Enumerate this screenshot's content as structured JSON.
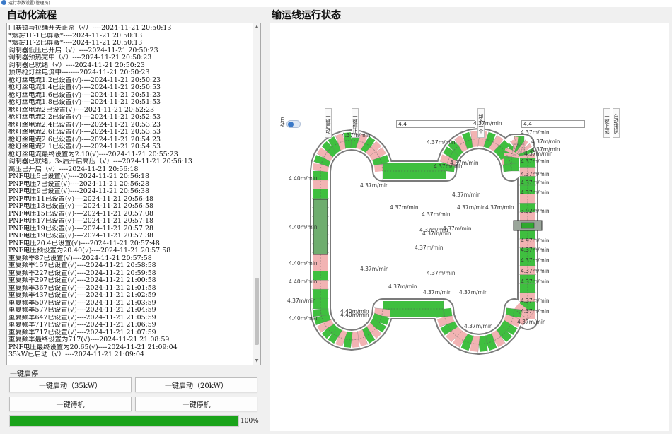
{
  "window": {
    "title": "运行参数设置(管理员)"
  },
  "left_panel": {
    "title": "自动化流程"
  },
  "right_panel": {
    "title": "输运线运行状态"
  },
  "log": [
    "门联锁与拉绳开关正常（√）----2024-11-21 20:50:13",
    "*烟雾1F-1已屏蔽*----2024-11-21 20:50:13",
    "*烟雾1F-2已屏蔽*----2024-11-21 20:50:13",
    "调制器低压已开启（√）----2024-11-21 20:50:23",
    "调制器预热完中（√）----2024-11-21 20:50:23",
    "调制器已就绪（√）----2024-11-21 20:50:23",
    "预热枪灯丝电流中--------2024-11-21 20:50:23",
    "枪灯丝电流1.2已设置(√)----2024-11-21 20:50:23",
    "枪灯丝电流1.4已设置(√)----2024-11-21 20:50:53",
    "枪灯丝电流1.6已设置(√)----2024-11-21 20:51:23",
    "枪灯丝电流1.8已设置(√)----2024-11-21 20:51:53",
    "枪灯丝电流2已设置(√)----2024-11-21 20:52:23",
    "枪灯丝电流2.2已设置(√)----2024-11-21 20:52:53",
    "枪灯丝电流2.4已设置(√)----2024-11-21 20:53:23",
    "枪灯丝电流2.6已设置(√)----2024-11-21 20:53:53",
    "枪灯丝电流2.6已设置(√)----2024-11-21 20:54:23",
    "枪灯丝电流2.1已设置(√)----2024-11-21 20:54:53",
    "枪灯丝电流最终设置为2.10(√)----2024-11-21 20:55:23",
    "调制器已就绪，3s后开启高压（√）----2024-11-21 20:56:13",
    "高压已开启（√）----2024-11-21 20:56:18",
    "PNF电压5已设置(√)----2024-11-21 20:56:18",
    "PNF电压7已设置(√)----2024-11-21 20:56:28",
    "PNF电压9已设置(√)----2024-11-21 20:56:38",
    "PNF电压11已设置(√)----2024-11-21 20:56:48",
    "PNF电压13已设置(√)----2024-11-21 20:56:58",
    "PNF电压15已设置(√)----2024-11-21 20:57:08",
    "PNF电压17已设置(√)----2024-11-21 20:57:18",
    "PNF电压19已设置(√)----2024-11-21 20:57:28",
    "PNF电压19已设置(√)----2024-11-21 20:57:38",
    "PNF电压20.4已设置(√)----2024-11-21 20:57:48",
    "PNF电压预设置为20.40(√)----2024-11-21 20:57:58",
    "重复频率87已设置(√)----2024-11-21 20:57:58",
    "重复频率157已设置(√)----2024-11-21 20:58:58",
    "重复频率227已设置(√)----2024-11-21 20:59:58",
    "重复频率297已设置(√)----2024-11-21 21:00:58",
    "重复频率367已设置(√)----2024-11-21 21:01:58",
    "重复频率437已设置(√)----2024-11-21 21:02:59",
    "重复频率507已设置(√)----2024-11-21 21:03:59",
    "重复频率577已设置(√)----2024-11-21 21:04:59",
    "重复频率647已设置(√)----2024-11-21 21:05:59",
    "重复频率717已设置(√)----2024-11-21 21:06:59",
    "重复频率717已设置(√)----2024-11-21 21:07:59",
    "重复频率最终设置为717(√)----2024-11-21 21:08:59",
    "PNF电压最终设置为20.65(√)----2024-11-21 21:09:04",
    "35kW已启动（√）----2024-11-21 21:09:04"
  ],
  "controls": {
    "section_label": "一键启停",
    "start_35": "一键启动（35kW）",
    "start_20": "一键启动（20kW）",
    "standby": "一键待机",
    "stop": "一键停机",
    "progress_percent": 100,
    "progress_text": "100%"
  },
  "conveyor": {
    "toggle_label": "自动",
    "toggle_on": true,
    "buttons": {
      "start_all": "一键启动",
      "stop_all": "一键停止",
      "unload": "卸下一个",
      "upload": "一键上载",
      "auto_sort": "自动排队"
    },
    "speed_input_left": "4.4",
    "speed_input_right": "4.4",
    "speed_labels": [
      "4.40m/min",
      "4.37m/min",
      "4.37m/min",
      "4.37m/min",
      "4.37m/min",
      "4.37m/min",
      "4.37m/min",
      "4.37m/min",
      "4.40m/min",
      "4.40m/min",
      "4.37m/min",
      "4.37m/min",
      "4.37m/min",
      "4.37m/min",
      "4.37m/min",
      "4.37m/min",
      "4.37m/min",
      "4.37m/min",
      "4.37m/min",
      "4.37m/min",
      "3.92m/min",
      "4.40m/min",
      "4.37m/min",
      "4.37m/min",
      "4.37m/min",
      "4.37m/min",
      "4.37m/min",
      "4.37m/min",
      "4.40m/min",
      "4.40m/min",
      "4.37m/min",
      "4.37m/min",
      "4.37m/min",
      "4.37m/min",
      "4.37m/min",
      "4.97m/min",
      "4.37m/min",
      "4.37m/min",
      "4.37m/min",
      "4.37m/min",
      "4.37m/min",
      "4.37m/min",
      "4.40m/min",
      "4.37m/min",
      "4.37m/min",
      "4.37m/min"
    ],
    "colors": {
      "loaded": "#3fbf3f",
      "empty": "#f2b3b3",
      "rail": "#7b7b7b"
    }
  }
}
